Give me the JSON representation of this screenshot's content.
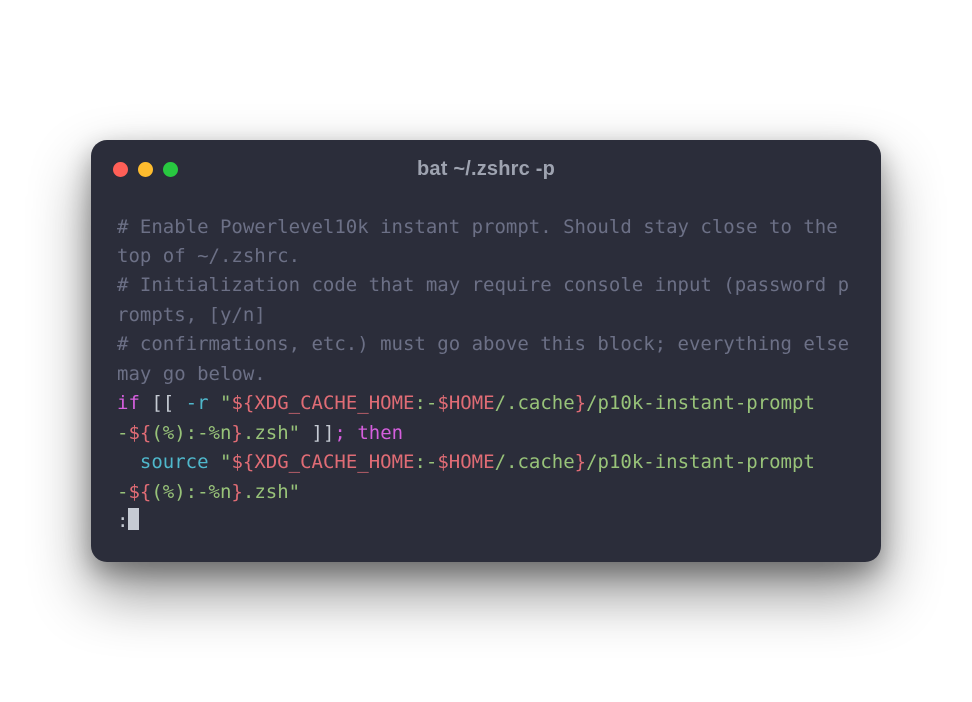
{
  "window": {
    "title": "bat ~/.zshrc -p"
  },
  "code": {
    "c1": "# Enable Powerlevel10k instant prompt. Should stay close to the top of ~/.zshrc.",
    "c2": "# Initialization code that may require console input (password prompts, [y/n]",
    "c3": "# confirmations, etc.) must go above this block; everything else may go below.",
    "kw_if": "if",
    "bracket_open": " [[ ",
    "flag_r": "-r",
    "space": " ",
    "q": "\"",
    "var1a": "${XDG_CACHE_HOME",
    "var1b": ":-",
    "var1c": "$HOME",
    "var1d": "/.cache",
    "var1e": "}",
    "path1": "/p10k-instant-prompt-",
    "var2a": "${",
    "var2b": "(%):-%n",
    "var2c": "}",
    "ext": ".zsh",
    "bracket_close": " ]]",
    "semi": ";",
    "kw_then": " then",
    "indent": "  ",
    "kw_source": "source",
    "pager": ":"
  }
}
